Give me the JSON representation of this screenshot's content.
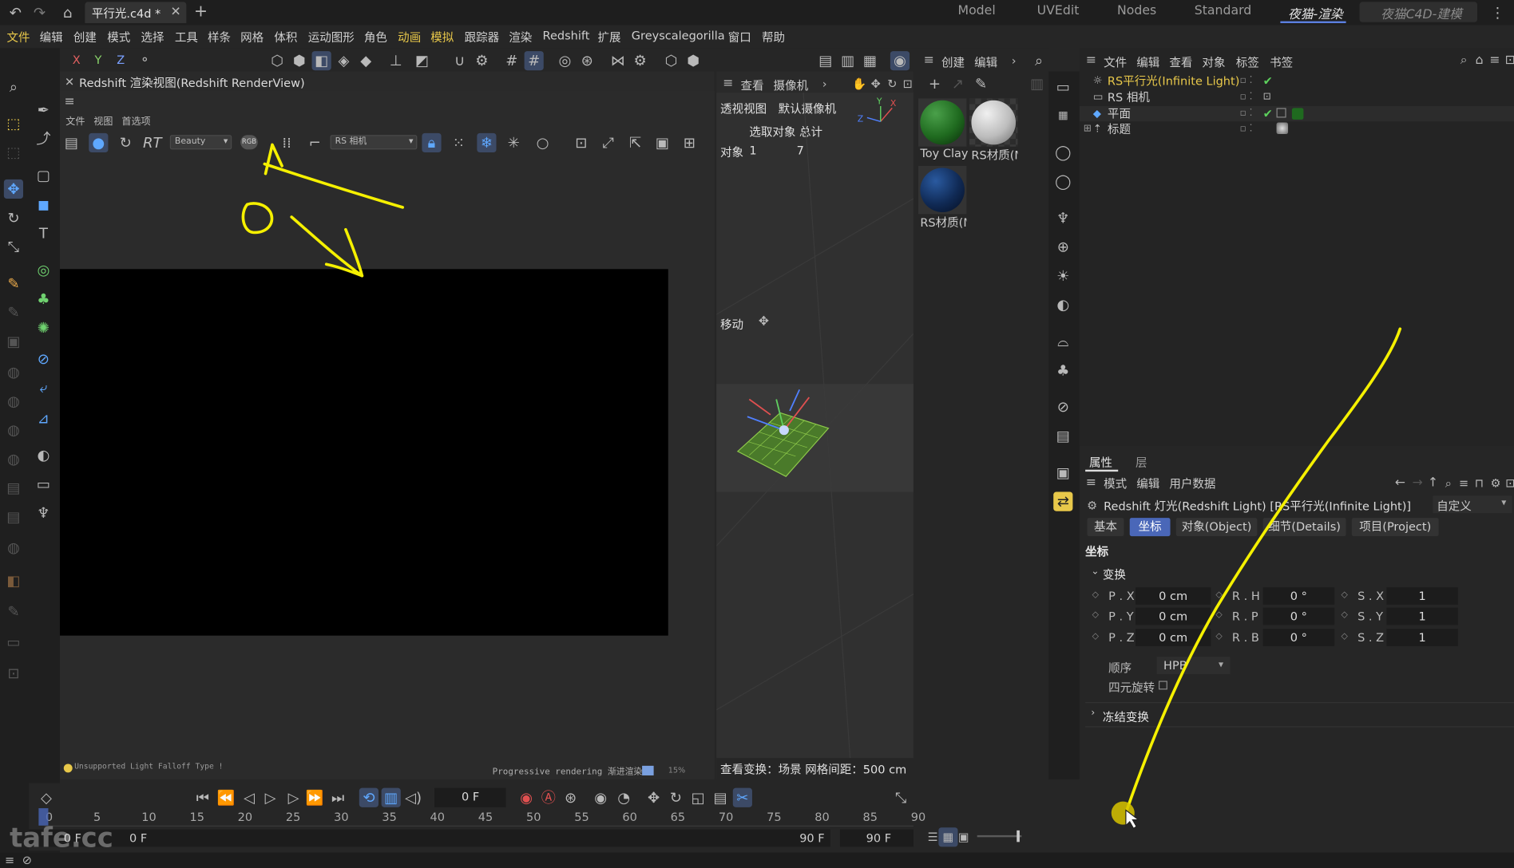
{
  "titlebar": {
    "file_tab": "平行光.c4d *",
    "layout_tabs": [
      "Model",
      "UVEdit",
      "Nodes",
      "Standard",
      "夜猫-渲染",
      "夜猫C4D-建模"
    ]
  },
  "menubar": [
    "文件",
    "编辑",
    "创建",
    "模式",
    "选择",
    "工具",
    "样条",
    "网格",
    "体积",
    "运动图形",
    "角色",
    "动画",
    "模拟",
    "跟踪器",
    "渲染",
    "Redshift",
    "扩展",
    "Greyscalegorilla",
    "窗口",
    "帮助"
  ],
  "axes": [
    "X",
    "Y",
    "Z"
  ],
  "renderview": {
    "title": "Redshift 渲染视图(Redshift RenderView)",
    "menu": [
      "文件",
      "视图",
      "首选项"
    ],
    "aov_dropdown": "Beauty",
    "rt_label": "RT",
    "rgb_label": "RGB",
    "camera_dropdown": "RS 相机",
    "status_left": "Unsupported Light Falloff Type !",
    "status_right": "Progressive rendering 渐进渲染",
    "progress_percent": "15%"
  },
  "viewport": {
    "menu": [
      "查看",
      "摄像机"
    ],
    "view_name": "透视视图",
    "camera_name": "默认摄像机",
    "hud_select": "选取对象 总计",
    "hud_object_label": "对象",
    "hud_selected": "1",
    "hud_total": "7",
    "move_label": "移动",
    "footer": "查看变换：场景   网格间距：500 cm"
  },
  "material_browser": {
    "menu": [
      "创建",
      "编辑"
    ],
    "materials": [
      {
        "name": "Toy Clay",
        "color": "#1f6a1f"
      },
      {
        "name": "RS材质(M",
        "color": "#bcbcbc"
      },
      {
        "name": "RS材质(M",
        "color": "#102a55"
      }
    ]
  },
  "object_manager": {
    "menu": [
      "文件",
      "编辑",
      "查看",
      "对象",
      "标签",
      "书签"
    ],
    "objects": [
      {
        "name": "RS平行光(Infinite Light)",
        "highlight": true
      },
      {
        "name": "RS 相机",
        "highlight": false
      },
      {
        "name": "平面",
        "highlight": false
      },
      {
        "name": "标题",
        "highlight": false
      }
    ]
  },
  "attributes": {
    "tabs": [
      "属性",
      "层"
    ],
    "menu": [
      "模式",
      "编辑",
      "用户数据"
    ],
    "object_title": "Redshift 灯光(Redshift Light) [RS平行光(Infinite Light)]",
    "preset": "自定义",
    "subtabs": [
      "基本",
      "坐标",
      "对象(Object)",
      "细节(Details)",
      "项目(Project)"
    ],
    "section": "坐标",
    "group_transform": "变换",
    "pos": [
      {
        "label": "P . X",
        "value": "0 cm"
      },
      {
        "label": "P . Y",
        "value": "0 cm"
      },
      {
        "label": "P . Z",
        "value": "0 cm"
      }
    ],
    "rot": [
      {
        "label": "R . H",
        "value": "0 °"
      },
      {
        "label": "R . P",
        "value": "0 °"
      },
      {
        "label": "R . B",
        "value": "0 °"
      }
    ],
    "scale": [
      {
        "label": "S . X",
        "value": "1"
      },
      {
        "label": "S . Y",
        "value": "1"
      },
      {
        "label": "S . Z",
        "value": "1"
      }
    ],
    "order_label": "顺序",
    "order_value": "HPB",
    "quaternion_label": "四元旋转",
    "freeze_label": "冻结变换"
  },
  "timeline": {
    "current_frame": "0 F",
    "ticks": [
      "0",
      "5",
      "10",
      "15",
      "20",
      "25",
      "30",
      "35",
      "40",
      "45",
      "50",
      "55",
      "60",
      "65",
      "70",
      "75",
      "80",
      "85",
      "90"
    ],
    "start": "0 F",
    "start2": "0 F",
    "end": "90 F",
    "end2": "90 F"
  },
  "watermark": "tafe.cc"
}
